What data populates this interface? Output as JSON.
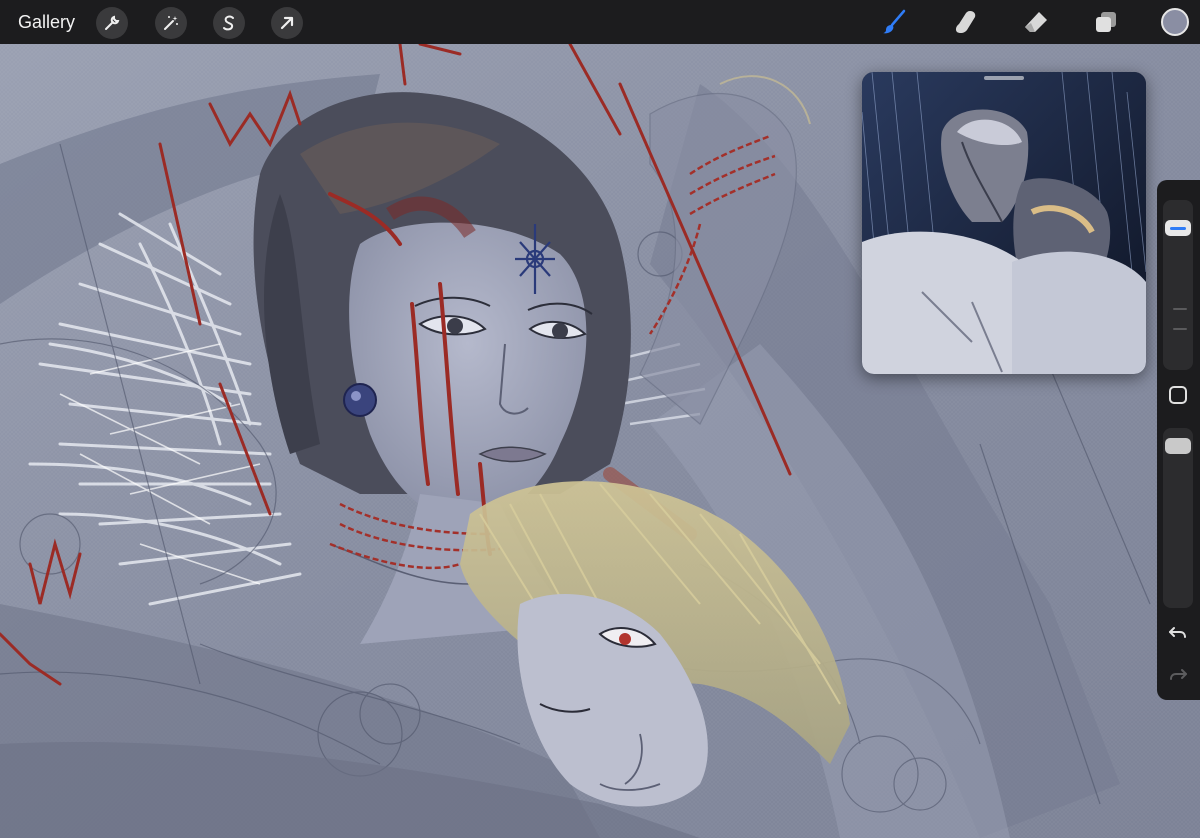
{
  "toolbar": {
    "gallery_label": "Gallery",
    "left_tools": [
      {
        "name": "actions",
        "icon": "wrench-icon"
      },
      {
        "name": "adjustments",
        "icon": "magic-wand-icon"
      },
      {
        "name": "selection",
        "icon": "selection-s-icon"
      },
      {
        "name": "transform",
        "icon": "arrow-cursor-icon"
      }
    ],
    "right_tools": [
      {
        "name": "paint",
        "icon": "brush-icon",
        "active": true
      },
      {
        "name": "smudge",
        "icon": "smudge-finger-icon",
        "active": false
      },
      {
        "name": "erase",
        "icon": "eraser-icon",
        "active": false
      },
      {
        "name": "layers",
        "icon": "layers-icon",
        "active": false
      }
    ],
    "current_color": "#8a8ea3",
    "active_tool_color": "#2f7cf6"
  },
  "sidebar": {
    "brush_size_level": 0.88,
    "brush_opacity_level": 0.95,
    "icons": [
      "modify-square-icon",
      "undo-arrow-icon",
      "redo-arrow-icon"
    ]
  },
  "reference": {
    "kind": "reference image window"
  },
  "palette": {
    "canvas_bg": "#8e95a6",
    "red_sketch": "#9b2b25",
    "blonde": "#c9c091",
    "white_fur": "#e4e7ee",
    "skin_blue": "#a6abc0",
    "hair_dark": "#4a4b57"
  }
}
